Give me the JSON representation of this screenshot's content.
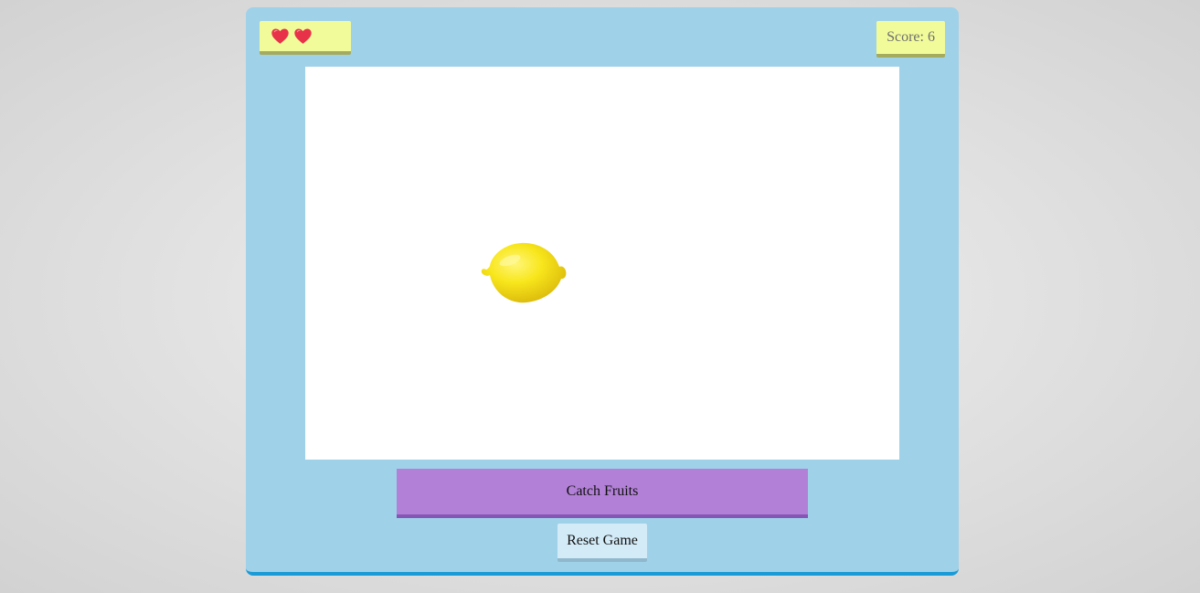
{
  "hud": {
    "lives_count": 2,
    "lives": [
      "heart-icon",
      "heart-icon"
    ],
    "score_label": "Score:",
    "score_value": "6"
  },
  "play_area": {
    "falling_fruit": "lemon"
  },
  "controls": {
    "catch_label": "Catch Fruits",
    "reset_label": "Reset Game"
  },
  "colors": {
    "panel": "#9fd1e9",
    "panel_edge": "#1a9ad6",
    "hud_box": "#f1fb9a",
    "heart": "#e8324a",
    "catch_button": "#b380d8",
    "reset_button": "#d3ebf7",
    "fruit": "#f5e21a"
  }
}
